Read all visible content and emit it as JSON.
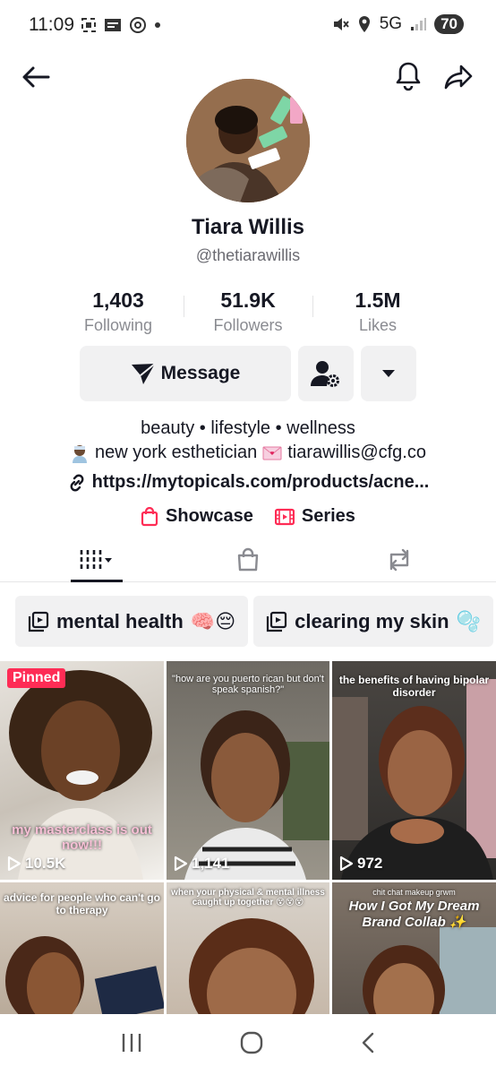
{
  "status_bar": {
    "time": "11:09",
    "network": "5G",
    "battery": "70"
  },
  "profile": {
    "name": "Tiara Willis",
    "handle": "@thetiarawillis",
    "stats": [
      {
        "value": "1,403",
        "label": "Following"
      },
      {
        "value": "51.9K",
        "label": "Followers"
      },
      {
        "value": "1.5M",
        "label": "Likes"
      }
    ],
    "message_label": "Message",
    "bio_line1": "beauty • lifestyle • wellness",
    "bio_line2_a": "new york esthetician",
    "bio_line2_b": "tiarawillis@cfg.co",
    "link": "https://mytopicals.com/products/acne...",
    "showcase_label": "Showcase",
    "series_label": "Series"
  },
  "playlists": [
    {
      "label": "mental health",
      "emoji": "🧠😔"
    },
    {
      "label": "clearing my skin",
      "emoji": "🫧"
    }
  ],
  "videos": [
    {
      "views": "10.5K",
      "pinned": "Pinned",
      "caption": "my masterclass is out now!!!"
    },
    {
      "views": "1,141",
      "caption": "\"how are you puerto rican but don't speak spanish?\""
    },
    {
      "views": "972",
      "caption": "the benefits of having bipolar disorder"
    },
    {
      "caption": "advice for people who can't go to therapy"
    },
    {
      "caption": "when your physical & mental illness caught up together 😵😵😵"
    },
    {
      "caption_small": "chit chat makeup grwm",
      "caption": "How I Got My Dream Brand Collab ✨"
    }
  ],
  "colors": {
    "accent": "#fe2c55",
    "text": "#161823",
    "muted": "#8a8b91",
    "button_bg": "#f1f1f2"
  }
}
